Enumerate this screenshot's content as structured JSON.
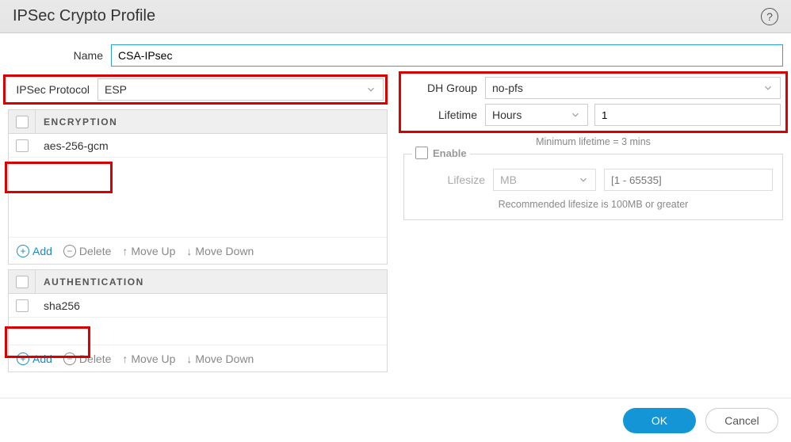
{
  "title": "IPSec Crypto Profile",
  "name_label": "Name",
  "name_value": "CSA-IPsec",
  "protocol_label": "IPSec Protocol",
  "protocol_value": "ESP",
  "encryption_header": "ENCRYPTION",
  "encryption_items": [
    "aes-256-gcm"
  ],
  "auth_header": "AUTHENTICATION",
  "auth_items": [
    "sha256"
  ],
  "actions": {
    "add": "Add",
    "delete": "Delete",
    "moveup": "Move Up",
    "movedown": "Move Down"
  },
  "dh_label": "DH Group",
  "dh_value": "no-pfs",
  "lifetime_label": "Lifetime",
  "lifetime_unit": "Hours",
  "lifetime_value": "1",
  "min_hint": "Minimum lifetime = 3 mins",
  "enable_label": "Enable",
  "lifesize_label": "Lifesize",
  "lifesize_unit": "MB",
  "lifesize_placeholder": "[1 - 65535]",
  "lifesize_hint": "Recommended lifesize is 100MB or greater",
  "ok": "OK",
  "cancel": "Cancel"
}
